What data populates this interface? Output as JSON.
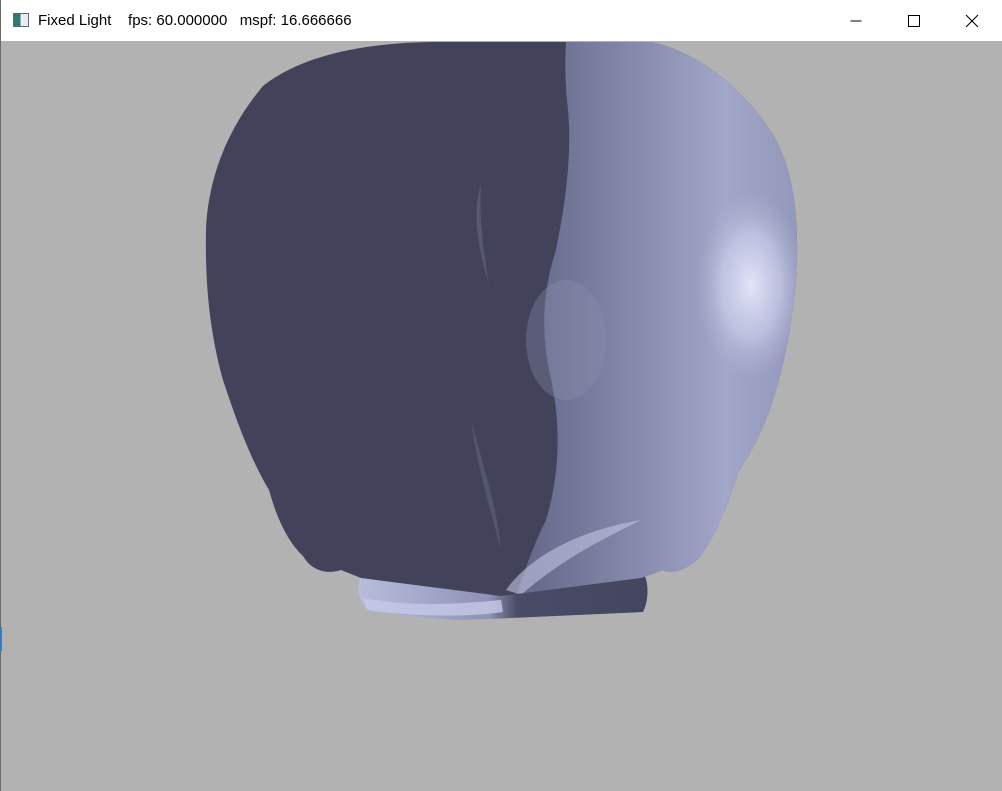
{
  "window": {
    "title": "Fixed Light    fps: 60.000000   mspf: 16.666666",
    "controls": {
      "minimize": "minimize-icon",
      "maximize": "maximize-icon",
      "close": "close-icon"
    }
  },
  "viewport": {
    "background_color": "#b2b2b2",
    "model": "lit-3d-head-mesh",
    "shadow_color": "#42425a",
    "lit_color": "#aeb2d2",
    "highlight_color": "#dcdef4"
  }
}
